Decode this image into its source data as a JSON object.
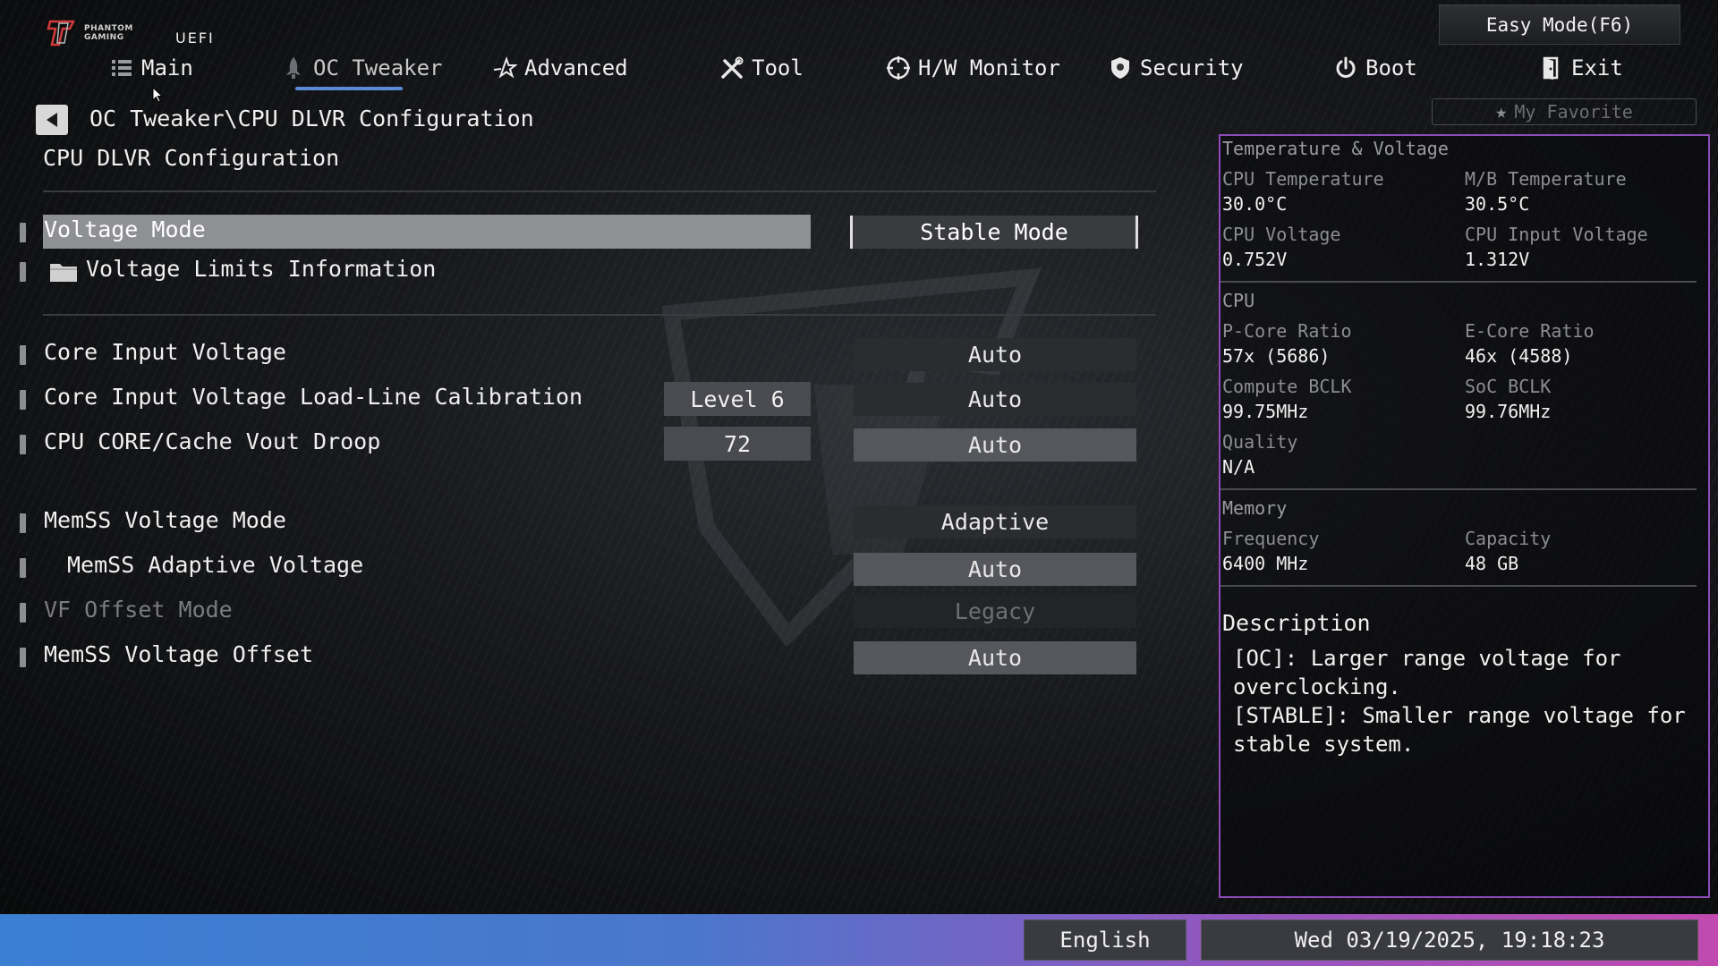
{
  "brand": {
    "line1": "PHANTOM",
    "line2": "GAMING",
    "product": "UEFI"
  },
  "top": {
    "easy_mode": "Easy Mode(F6)",
    "favorite": "My Favorite"
  },
  "nav": {
    "items": [
      {
        "label": "Main",
        "icon": "list-icon"
      },
      {
        "label": "OC Tweaker",
        "icon": "rocket-icon"
      },
      {
        "label": "Advanced",
        "icon": "star-swoosh-icon"
      },
      {
        "label": "Tool",
        "icon": "tools-icon"
      },
      {
        "label": "H/W Monitor",
        "icon": "crosshair-icon"
      },
      {
        "label": "Security",
        "icon": "shield-icon"
      },
      {
        "label": "Boot",
        "icon": "power-icon"
      },
      {
        "label": "Exit",
        "icon": "door-icon"
      }
    ],
    "active": "OC Tweaker"
  },
  "breadcrumb": "OC Tweaker\\CPU DLVR Configuration",
  "page_title": "CPU DLVR Configuration",
  "settings": [
    {
      "label": "Voltage Mode",
      "value": "Stable Mode"
    },
    {
      "label": "Voltage Limits Information"
    },
    {
      "label": "Core Input Voltage",
      "value": "Auto"
    },
    {
      "label": "Core Input Voltage Load-Line Calibration",
      "current": "Level 6",
      "value": "Auto"
    },
    {
      "label": "CPU CORE/Cache Vout Droop",
      "current": "72",
      "value": "Auto"
    },
    {
      "label": "MemSS Voltage Mode",
      "value": "Adaptive"
    },
    {
      "label": "MemSS Adaptive Voltage",
      "value": "Auto"
    },
    {
      "label": "VF Offset Mode",
      "value": "Legacy"
    },
    {
      "label": "MemSS Voltage Offset",
      "value": "Auto"
    }
  ],
  "monitor": {
    "tv_header": "Temperature & Voltage",
    "cpu_temp_label": "CPU Temperature",
    "cpu_temp": "30.0°C",
    "mb_temp_label": "M/B Temperature",
    "mb_temp": "30.5°C",
    "cpu_volt_label": "CPU Voltage",
    "cpu_volt": "0.752V",
    "cpu_in_volt_label": "CPU Input Voltage",
    "cpu_in_volt": "1.312V",
    "cpu_header": "CPU",
    "pcore_label": "P-Core Ratio",
    "pcore": "57x (5686)",
    "ecore_label": "E-Core Ratio",
    "ecore": "46x (4588)",
    "cbclk_label": "Compute BCLK",
    "cbclk": "99.75MHz",
    "socbclk_label": "SoC BCLK",
    "socbclk": "99.76MHz",
    "quality_label": "Quality",
    "quality": "N/A",
    "mem_header": "Memory",
    "freq_label": "Frequency",
    "freq": "6400 MHz",
    "cap_label": "Capacity",
    "cap": "48 GB"
  },
  "description": {
    "title": "Description",
    "body": "[OC]: Larger range voltage for\noverclocking.\n[STABLE]: Smaller range voltage for\nstable system."
  },
  "footer": {
    "language": "English",
    "datetime": "Wed 03/19/2025, 19:18:23"
  },
  "colors": {
    "accent_blue": "#5c8ad8",
    "panel_border": "#8e4bb8",
    "footer_left": "#3b7fd3",
    "footer_right": "#c149b0"
  }
}
